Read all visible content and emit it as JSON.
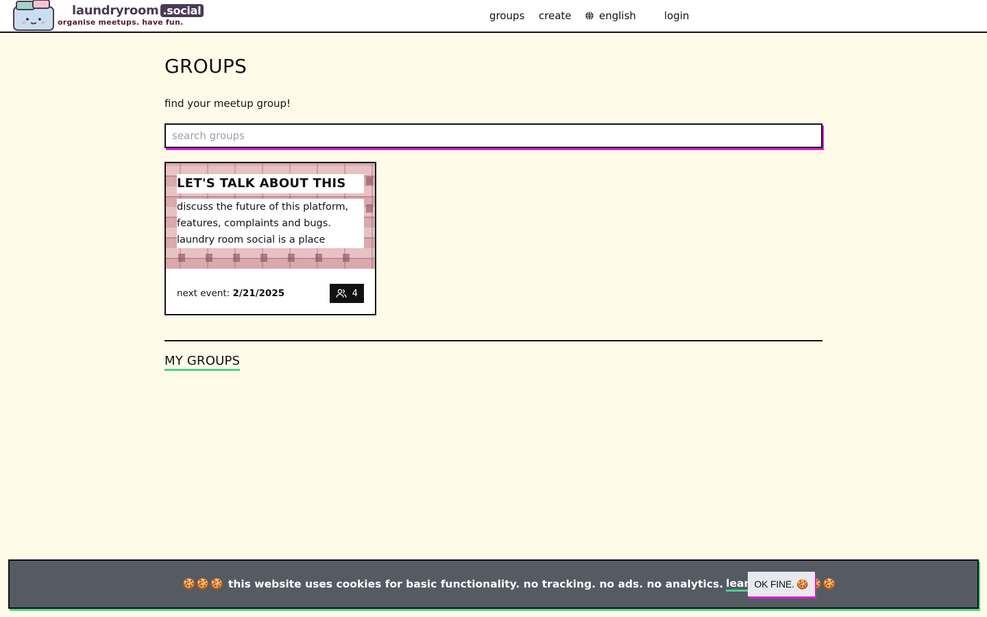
{
  "header": {
    "brand_name": "laundryroom",
    "brand_tld": ".social",
    "tagline": "organise meetups. have fun.",
    "nav": {
      "groups": "groups",
      "create": "create",
      "language": "english",
      "login": "login"
    }
  },
  "main": {
    "title": "GROUPS",
    "subtitle": "find your meetup group!",
    "search_placeholder": "search groups",
    "groups": [
      {
        "title": "LET'S TALK ABOUT THIS",
        "description": "discuss the future of this platform, features, complaints and bugs. laundry room social is a place",
        "next_event_label": "next event:",
        "next_event_date": "2/21/2025",
        "member_count": "4"
      }
    ],
    "my_groups_heading": "MY GROUPS"
  },
  "cookie_banner": {
    "glyphs_before": "🍪🍪🍪",
    "message": "this website uses cookies for basic functionality. no tracking. no ads. no analytics.",
    "learn_more": "learn more",
    "glyphs_after": "🍪🍪🍪",
    "ok_button": "OK FINE. 🍪"
  },
  "colors": {
    "page_background": "#fefbe9",
    "accent_magenta": "#e21bd9",
    "accent_green": "#4cd186",
    "banner_background": "#555b63",
    "brand_purple": "#4a3a55"
  },
  "icons": {
    "language": "globe-icon",
    "members": "users-icon"
  }
}
